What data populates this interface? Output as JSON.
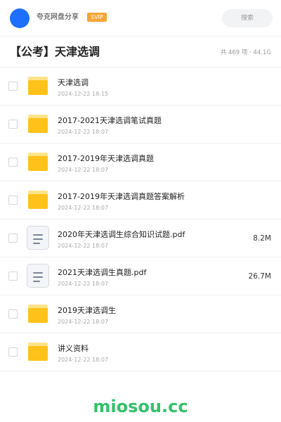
{
  "header": {
    "share_name": "夸克网盘分享",
    "vip_badge": "SVIP",
    "search_placeholder": "搜索",
    "avatar_color": "#1f6fff"
  },
  "folder": {
    "title": "【公考】天津选调",
    "meta": "共 469 项 · 44.1G"
  },
  "files": [
    {
      "name": "天津选调",
      "date": "2024-12-22 18:15",
      "size": "",
      "type": "folder-icon"
    },
    {
      "name": "2017-2021天津选调笔试真题",
      "date": "2024-12-22 18:07",
      "size": "",
      "type": "folder-icon"
    },
    {
      "name": "2017-2019年天津选调真题",
      "date": "2024-12-22 18:07",
      "size": "",
      "type": "folder-icon"
    },
    {
      "name": "2017-2019年天津选调真题答案解析",
      "date": "2024-12-22 18:07",
      "size": "",
      "type": "folder-icon"
    },
    {
      "name": "2020年天津选调生综合知识试题.pdf",
      "date": "2024-12-22 18:07",
      "size": "8.2M",
      "type": "document-icon"
    },
    {
      "name": "2021天津选调生真题.pdf",
      "date": "2024-12-22 18:07",
      "size": "26.7M",
      "type": "document-icon"
    },
    {
      "name": "2019天津选调生",
      "date": "2024-12-22 18:07",
      "size": "",
      "type": "folder-icon"
    },
    {
      "name": "讲义资料",
      "date": "2024-12-22 18:07",
      "size": "",
      "type": "folder-icon"
    }
  ],
  "watermark": "miosou.cc",
  "colors": {
    "folder": "#ffc21a",
    "vip": "#f7a534",
    "watermark": "#33c26b"
  }
}
